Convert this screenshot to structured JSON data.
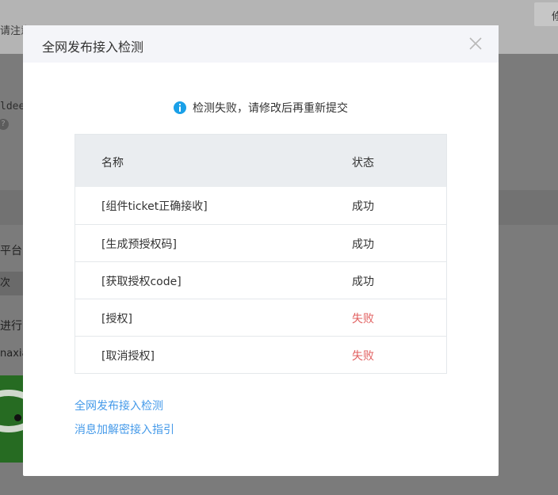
{
  "background": {
    "notice": "请注意",
    "corner_button": "修",
    "app_id_fragment": "ldee",
    "help_icon": "question-icon",
    "platform_label": "平台",
    "tab_fragment": "次",
    "proceed_fragment": "进行",
    "name_fragment": "naxia"
  },
  "modal": {
    "title": "全网发布接入检测",
    "status_message": "检测失败，请修改后再重新提交",
    "table": {
      "headers": {
        "name": "名称",
        "status": "状态"
      },
      "rows": [
        {
          "name": "[组件ticket正确接收]",
          "status": "成功",
          "state": "success"
        },
        {
          "name": "[生成预授权码]",
          "status": "成功",
          "state": "success"
        },
        {
          "name": "[获取授权code]",
          "status": "成功",
          "state": "success"
        },
        {
          "name": "[授权]",
          "status": "失败",
          "state": "fail"
        },
        {
          "name": "[取消授权]",
          "status": "失败",
          "state": "fail"
        }
      ]
    },
    "links": {
      "publish_check": "全网发布接入检测",
      "decrypt_guide": "消息加解密接入指引"
    }
  },
  "colors": {
    "info_blue": "#1aa0e8",
    "link_blue": "#459ae9",
    "fail_red": "#e15f5f"
  }
}
